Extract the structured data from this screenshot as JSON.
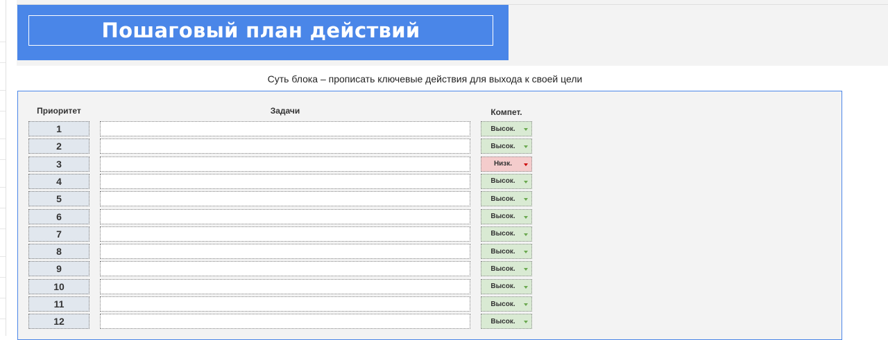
{
  "header": {
    "title": "Пошаговый план действий"
  },
  "subtitle": "Суть блока – прописать ключевые действия для выхода к своей цели",
  "table": {
    "headers": {
      "priority": "Приоритет",
      "tasks": "Задачи",
      "competence": "Компет."
    },
    "rows": [
      {
        "priority": "1",
        "task": "",
        "competence": "Высок.",
        "level": "high"
      },
      {
        "priority": "2",
        "task": "",
        "competence": "Высок.",
        "level": "high"
      },
      {
        "priority": "3",
        "task": "",
        "competence": "Низк.",
        "level": "low"
      },
      {
        "priority": "4",
        "task": "",
        "competence": "Высок.",
        "level": "high"
      },
      {
        "priority": "5",
        "task": "",
        "competence": "Высок.",
        "level": "high"
      },
      {
        "priority": "6",
        "task": "",
        "competence": "Высок.",
        "level": "high"
      },
      {
        "priority": "7",
        "task": "",
        "competence": "Высок.",
        "level": "high"
      },
      {
        "priority": "8",
        "task": "",
        "competence": "Высок.",
        "level": "high"
      },
      {
        "priority": "9",
        "task": "",
        "competence": "Высок.",
        "level": "high"
      },
      {
        "priority": "10",
        "task": "",
        "competence": "Высок.",
        "level": "high"
      },
      {
        "priority": "11",
        "task": "",
        "competence": "Высок.",
        "level": "high"
      },
      {
        "priority": "12",
        "task": "",
        "competence": "Высок.",
        "level": "high"
      }
    ]
  },
  "colors": {
    "title_bg": "#4a86e8",
    "panel_border": "#4a86e8",
    "high_bg": "#d9ead3",
    "low_bg": "#f4cccc",
    "priority_bg": "#e1e7ee"
  },
  "icons": {
    "dropdown": "dropdown-caret-icon"
  }
}
